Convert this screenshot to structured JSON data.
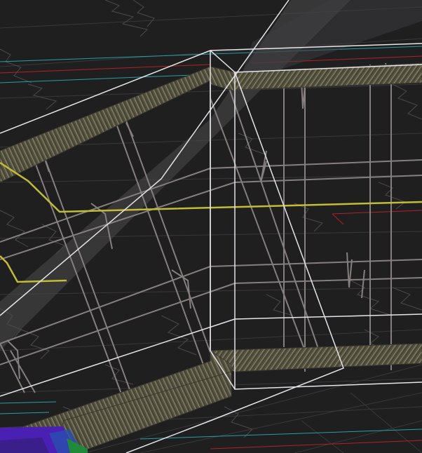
{
  "viewport": {
    "background_color": "#1f1f20",
    "colors": {
      "grid_line": "#3a3a3c",
      "contour_line": "#4d4d50",
      "edge_white": "#e9e9ec",
      "edge_grey": "#8a8485",
      "rebar_dark": "#5a5748",
      "rebar_light": "#8a8670",
      "selection_highlight": "#3a3a3c",
      "yellow_line": "#c8c23a",
      "cyan_line": "#2aa9b0",
      "red_line": "#c0282e",
      "purple_block": "#4a1fb0",
      "green_block": "#1f8a3a",
      "blue_block": "#2a4fb0"
    },
    "icons": []
  }
}
